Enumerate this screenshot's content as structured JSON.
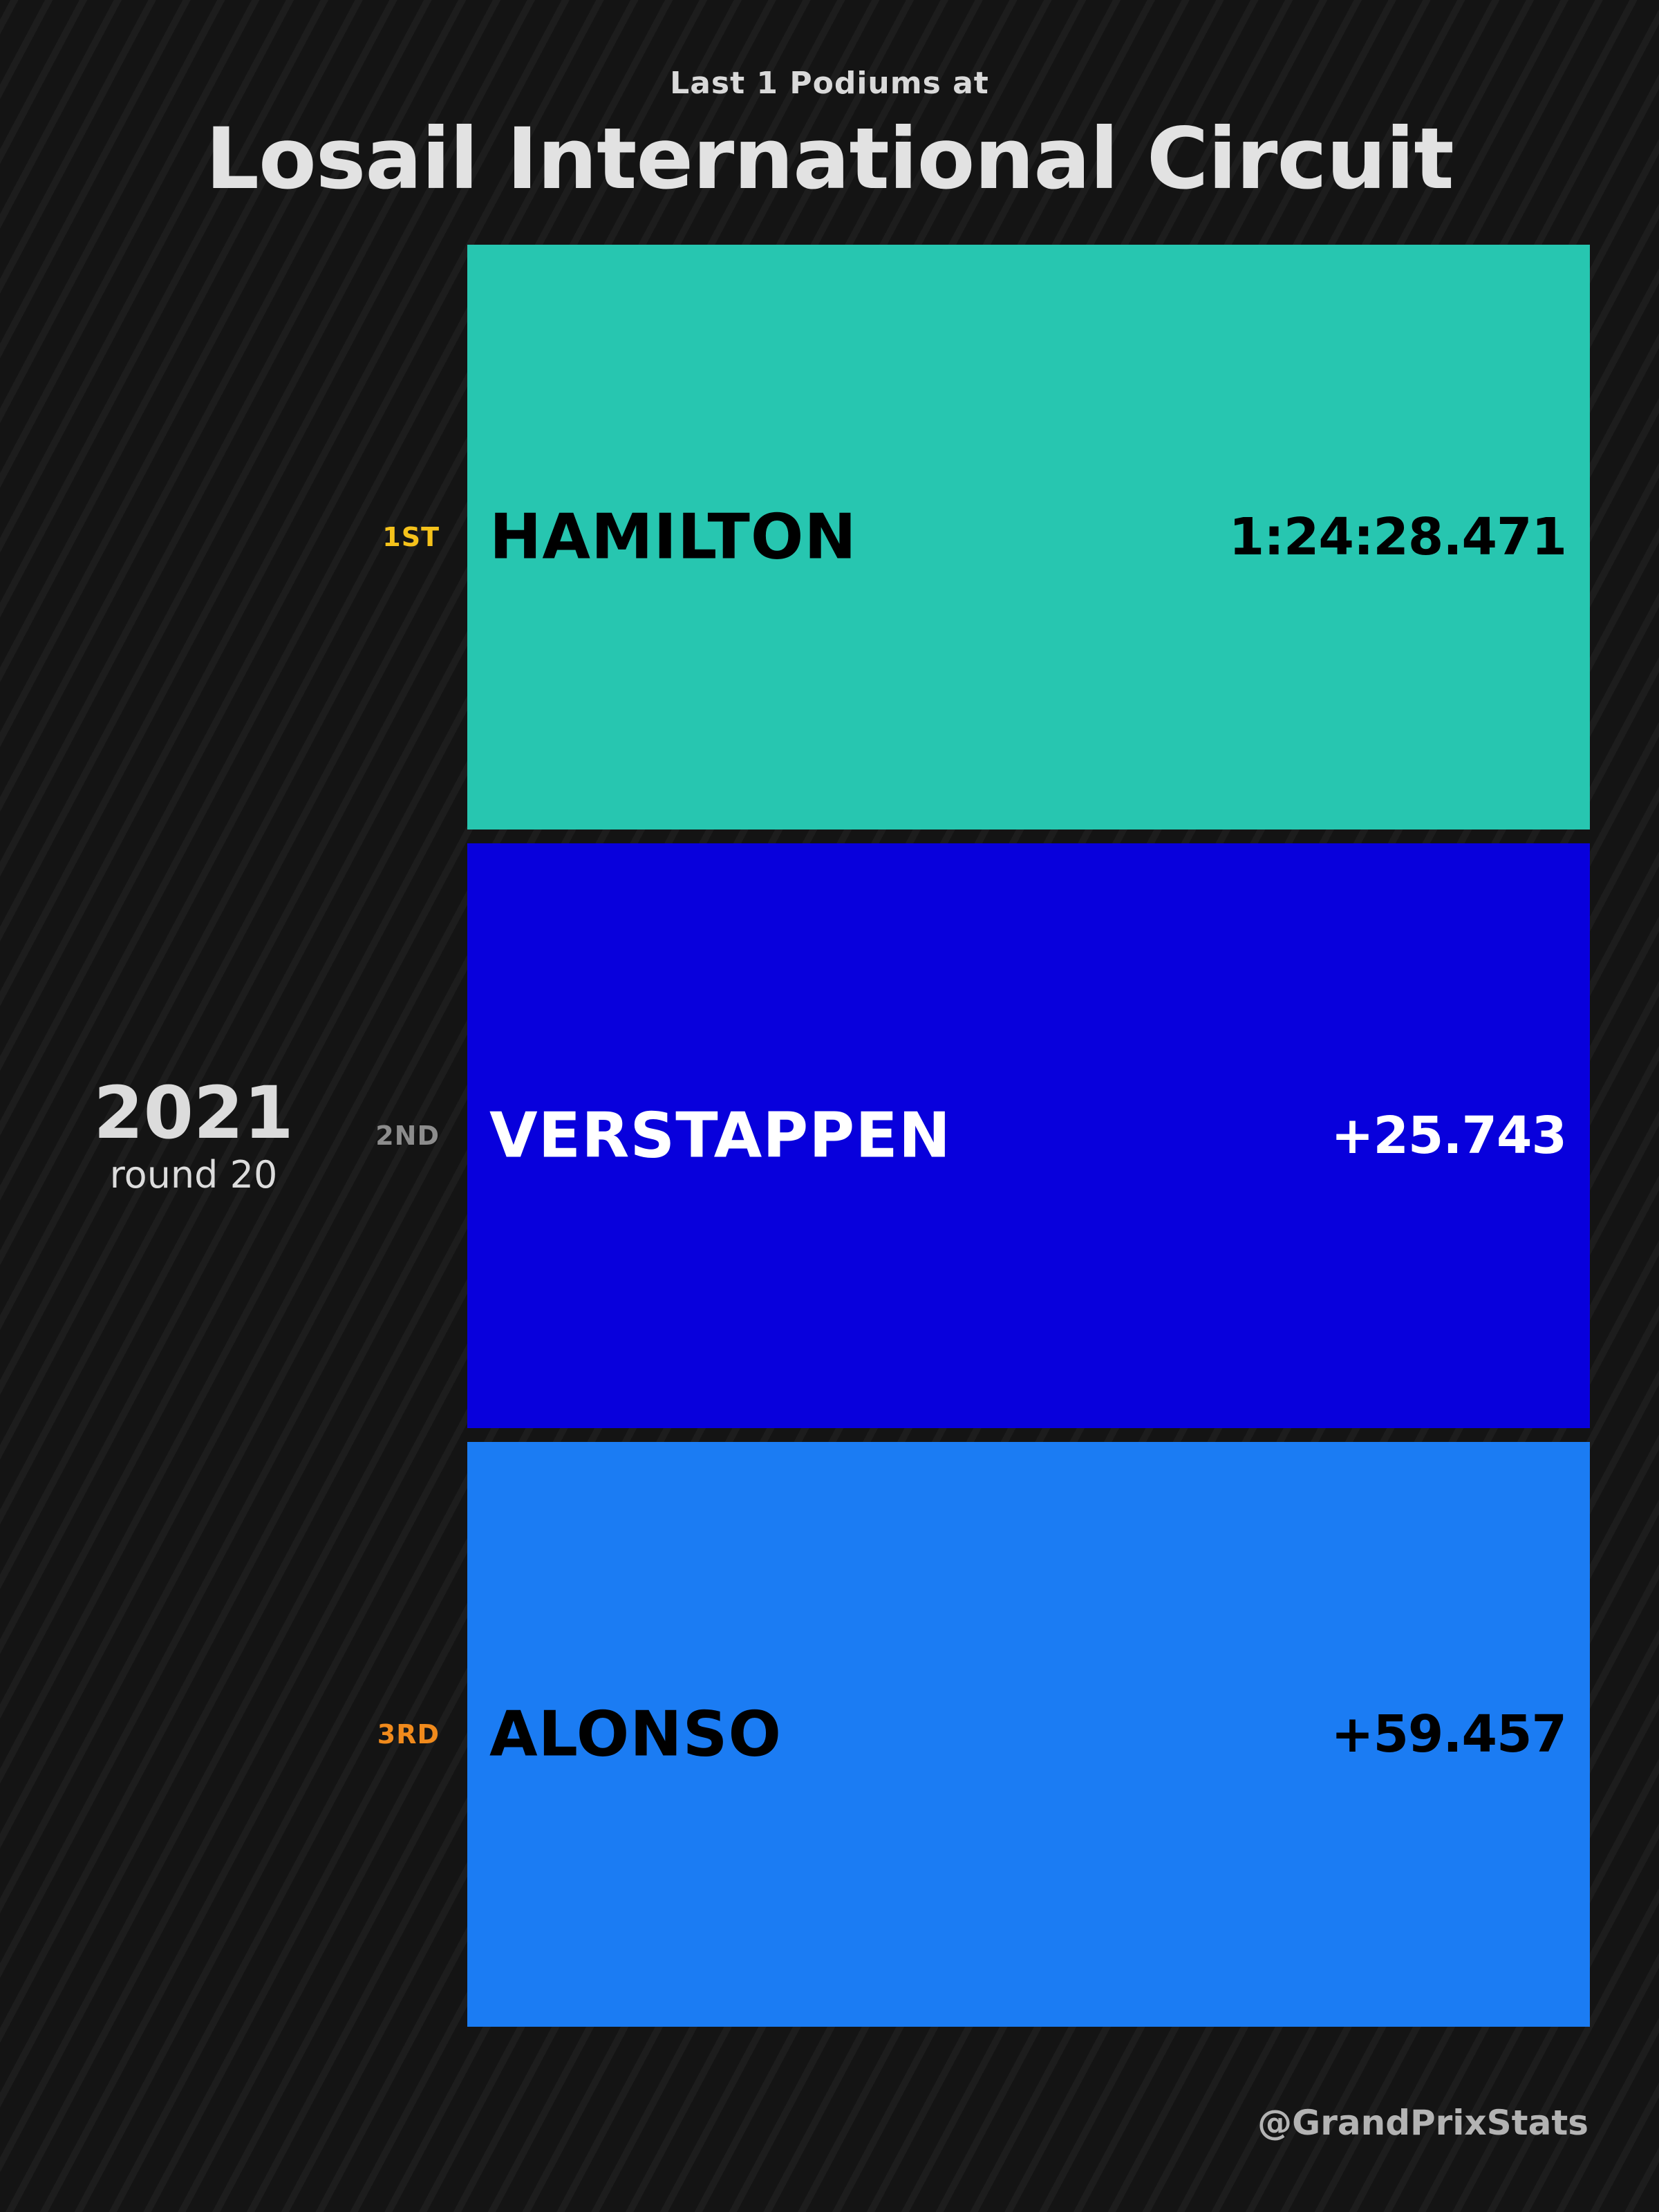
{
  "header": {
    "subtitle": "Last 1 Podiums at",
    "title": "Losail International Circuit"
  },
  "race": {
    "year": "2021",
    "round": "round 20"
  },
  "chart_data": {
    "type": "table",
    "title": "Losail International Circuit",
    "subtitle": "Last 1 Podiums at",
    "rows": [
      {
        "position": "1ST",
        "position_color": "#f5c21b",
        "driver": "HAMILTON",
        "result": "1:24:28.471",
        "bar_color": "#27c6b0",
        "text_color": "#000000"
      },
      {
        "position": "2ND",
        "position_color": "#8c8c8c",
        "driver": "VERSTAPPEN",
        "result": "+25.743",
        "bar_color": "#0800dc",
        "text_color": "#ffffff"
      },
      {
        "position": "3RD",
        "position_color": "#f08a1c",
        "driver": "ALONSO",
        "result": "+59.457",
        "bar_color": "#1b7cf3",
        "text_color": "#000000"
      }
    ]
  },
  "footer": {
    "credit": "@GrandPrixStats"
  }
}
